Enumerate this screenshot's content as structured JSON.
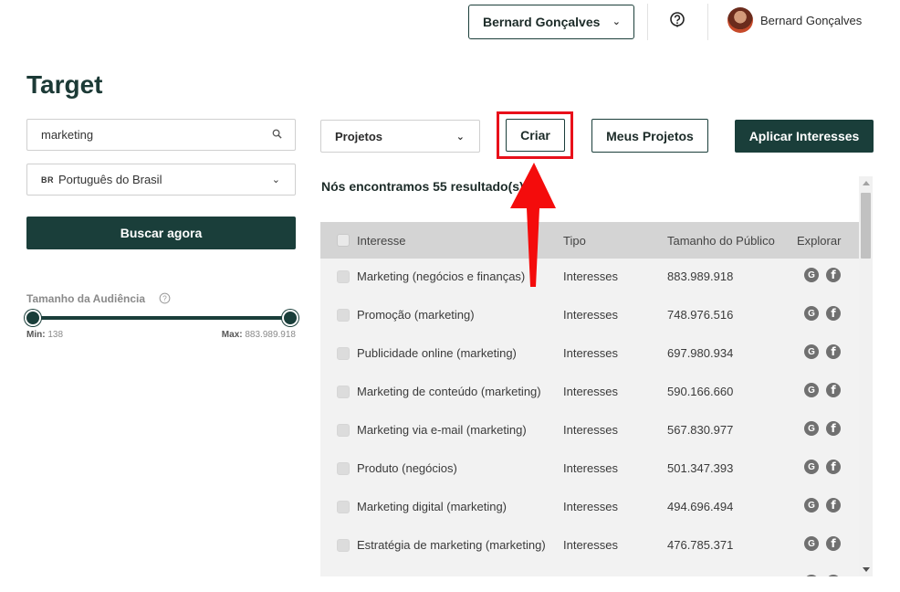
{
  "header": {
    "account_selector": "Bernard Gonçalves",
    "user_name": "Bernard Gonçalves",
    "help_icon": "question-circle-icon"
  },
  "page": {
    "title": "Target"
  },
  "left_panel": {
    "search_value": "marketing",
    "language_flag": "BR",
    "language": "Português do Brasil",
    "search_button": "Buscar agora",
    "audience_label": "Tamanho da Audiência",
    "slider_min_label": "Min:",
    "slider_min_value": "138",
    "slider_max_label": "Max:",
    "slider_max_value": "883.989.918"
  },
  "toolbar": {
    "projects_select": "Projetos",
    "create_button": "Criar",
    "my_projects_button": "Meus Projetos",
    "apply_button": "Aplicar Interesses"
  },
  "results": {
    "count_text": "Nós encontramos 55 resultado(s)",
    "columns": [
      "Interesse",
      "Tipo",
      "Tamanho do Público",
      "Explorar"
    ],
    "rows": [
      {
        "interest": "Marketing (negócios e finanças)",
        "type": "Interesses",
        "size": "883.989.918"
      },
      {
        "interest": "Promoção (marketing)",
        "type": "Interesses",
        "size": "748.976.516"
      },
      {
        "interest": "Publicidade online (marketing)",
        "type": "Interesses",
        "size": "697.980.934"
      },
      {
        "interest": "Marketing de conteúdo (marketing)",
        "type": "Interesses",
        "size": "590.166.660"
      },
      {
        "interest": "Marketing via e-mail (marketing)",
        "type": "Interesses",
        "size": "567.830.977"
      },
      {
        "interest": "Produto (negócios)",
        "type": "Interesses",
        "size": "501.347.393"
      },
      {
        "interest": "Marketing digital (marketing)",
        "type": "Interesses",
        "size": "494.696.494"
      },
      {
        "interest": "Estratégia de marketing (marketing)",
        "type": "Interesses",
        "size": "476.785.371"
      },
      {
        "interest": "",
        "type": "",
        "size": ""
      }
    ],
    "explore_icons": [
      "google-icon",
      "facebook-icon"
    ]
  },
  "colors": {
    "brand": "#1a3e3a",
    "highlight_red": "#e8101a"
  }
}
